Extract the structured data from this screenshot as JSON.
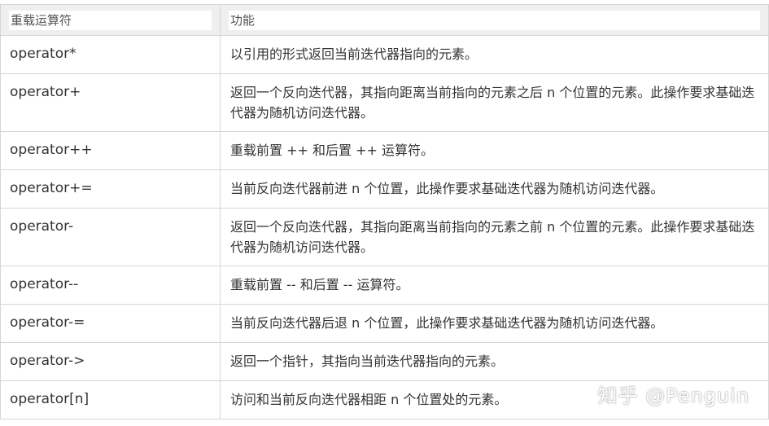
{
  "table": {
    "headers": [
      "重载运算符",
      "功能"
    ],
    "rows": [
      {
        "op": "operator*",
        "desc": "以引用的形式返回当前迭代器指向的元素。"
      },
      {
        "op": "operator+",
        "desc": "返回一个反向迭代器，其指向距离当前指向的元素之后 n 个位置的元素。此操作要求基础迭代器为随机访问迭代器。"
      },
      {
        "op": "operator++",
        "desc": "重载前置 ++ 和后置 ++ 运算符。"
      },
      {
        "op": "operator+=",
        "desc": "当前反向迭代器前进 n 个位置，此操作要求基础迭代器为随机访问迭代器。"
      },
      {
        "op": "operator-",
        "desc": "返回一个反向迭代器，其指向距离当前指向的元素之前 n 个位置的元素。此操作要求基础迭代器为随机访问迭代器。"
      },
      {
        "op": "operator--",
        "desc": "重载前置 -- 和后置 -- 运算符。"
      },
      {
        "op": "operator-=",
        "desc": "当前反向迭代器后退 n 个位置，此操作要求基础迭代器为随机访问迭代器。"
      },
      {
        "op": "operator->",
        "desc": "返回一个指针，其指向当前迭代器指向的元素。"
      },
      {
        "op": "operator[n]",
        "desc": "访问和当前反向迭代器相距 n 个位置处的元素。"
      }
    ]
  },
  "watermark": "知乎 @Penguin"
}
